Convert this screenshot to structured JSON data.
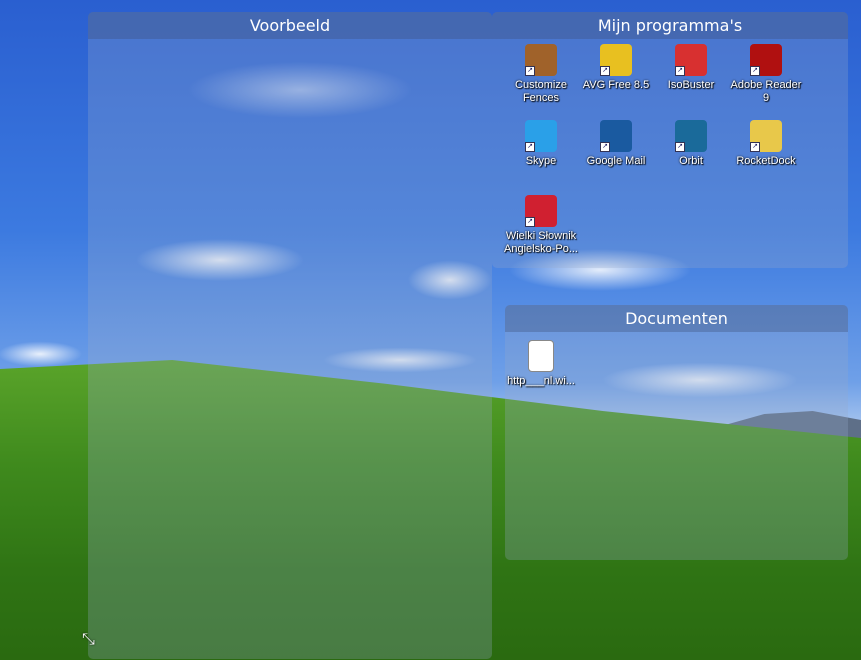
{
  "fences": [
    {
      "title": "Voorbeeld",
      "icons": []
    },
    {
      "title": "Mijn programma's",
      "icons": [
        {
          "label": "Customize Fences",
          "icon": "fences-icon",
          "color": "#a0622a"
        },
        {
          "label": "AVG Free 8.5",
          "icon": "avg-icon",
          "color": "#e8c020"
        },
        {
          "label": "IsoBuster",
          "icon": "isobuster-icon",
          "color": "#d83030"
        },
        {
          "label": "Adobe Reader 9",
          "icon": "adobe-reader-icon",
          "color": "#b01010"
        },
        {
          "label": "Skype",
          "icon": "skype-icon",
          "color": "#2aa0e8"
        },
        {
          "label": "Google Mail",
          "icon": "globe-icon",
          "color": "#1a5aa0"
        },
        {
          "label": "Orbit",
          "icon": "orbit-download-icon",
          "color": "#1a6a9a"
        },
        {
          "label": "RocketDock",
          "icon": "rocketdock-icon",
          "color": "#e8c84a"
        },
        {
          "label": "Wielki Słownik Angielsko-Po...",
          "icon": "dictionary-flag-icon",
          "color": "#d02030"
        }
      ]
    },
    {
      "title": "Documenten",
      "icons": [
        {
          "label": "http___nl.wi...",
          "icon": "pdf-file-icon",
          "color": "#ffffff"
        }
      ]
    }
  ],
  "shortcut_arrow": "↗",
  "resize_handle": "⤡"
}
